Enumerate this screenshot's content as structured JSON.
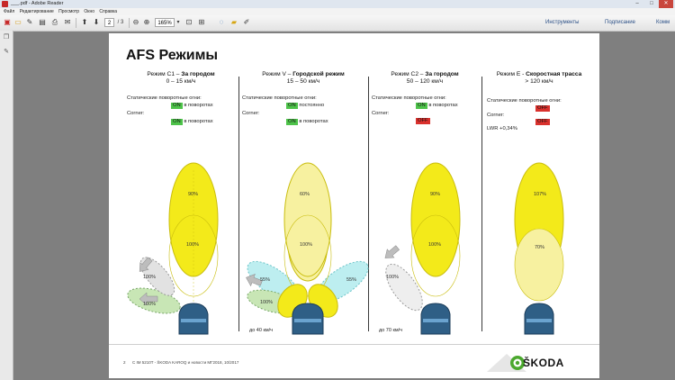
{
  "window": {
    "title": "___.pdf - Adobe Reader",
    "minimize": "–",
    "maximize": "□",
    "close": "✕"
  },
  "menu": [
    "Файл",
    "Редактирование",
    "Просмотр",
    "Окно",
    "Справка"
  ],
  "toolbar": {
    "page_current": "2",
    "page_total": "/ 3",
    "zoom": "165%",
    "tools_label": "Инструменты",
    "sign_label": "Подписание",
    "comment_label": "Комм"
  },
  "slide": {
    "title": "AFS Режимы",
    "modes": [
      {
        "head_plain": "Режим C1 – ",
        "head_bold": "За городом",
        "head_line2": "0 – 15 км/ч",
        "static_label": "Статические поворотные огни:",
        "static_badge": "ON",
        "static_text": "в поворотах",
        "corner_label": "Corner:",
        "corner_badge": "ON",
        "corner_text": "в поворотах",
        "pct_top": "90%",
        "pct_mid": "100%",
        "pct_side_a": "100%",
        "pct_side_b": "100%",
        "bottom_note": ""
      },
      {
        "head_plain": "Режим V – ",
        "head_bold": "Городской режим",
        "head_line2": "15 – 50 км/ч",
        "static_label": "Статические поворотные огни:",
        "static_badge": "ON",
        "static_text": "постоянно",
        "corner_label": "Corner:",
        "corner_badge": "ON",
        "corner_text": "в поворотах",
        "pct_top": "60%",
        "pct_mid": "100%",
        "pct_side_a": "55%",
        "pct_side_b": "55%",
        "pct_side_c": "100%",
        "bottom_note": "до 40 км/ч"
      },
      {
        "head_plain": "Режим C2 – ",
        "head_bold": "За городом",
        "head_line2": "50 – 120 км/ч",
        "static_label": "Статические поворотные огни:",
        "static_badge": "ON",
        "static_text": "в поворотах",
        "corner_label": "Corner:",
        "corner_badge": "OFF",
        "corner_text": "",
        "pct_top": "90%",
        "pct_mid": "100%",
        "pct_side_a": "100%",
        "bottom_note": "до 70 км/ч"
      },
      {
        "head_plain": "Режим E - ",
        "head_bold": "Скоростная трасса",
        "head_line2": "> 120 км/ч",
        "static_label": "Статические поворотные огни:",
        "static_badge": "OFF",
        "static_text": "",
        "corner_label": "Corner:",
        "corner_badge": "OFF",
        "corner_text": "",
        "lwr": "LWR +0,34%",
        "pct_top": "107%",
        "pct_mid": "70%",
        "bottom_note": ""
      }
    ],
    "footer_page": "2",
    "footer_text": "C IM 5210T - ŠKODA KAROQ и новости MГ2018, 10/2017",
    "brand": "ŠKODA"
  },
  "colors": {
    "beam_yellow": "#f3ea1a",
    "beam_pale": "#f7f1a0",
    "side_grey": "#d9d9d9",
    "side_green": "#c8e6b5",
    "side_cyan": "#bdeef0",
    "on_green": "#4ec34a",
    "off_red": "#d9312d",
    "lamp_blue": "#2f5f86"
  }
}
